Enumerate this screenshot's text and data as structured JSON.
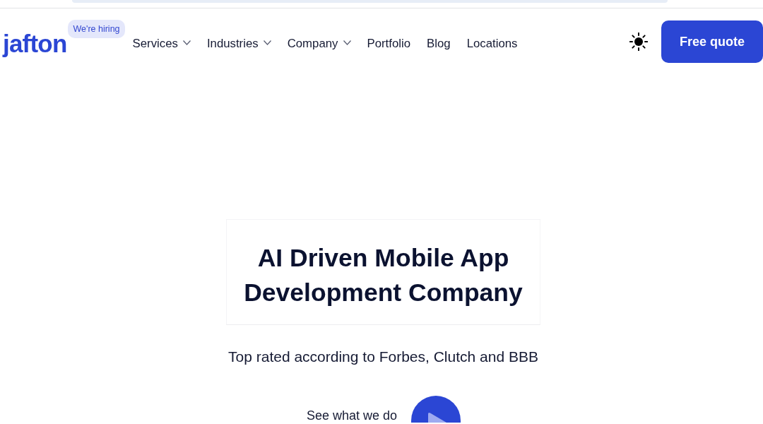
{
  "header": {
    "logo": "jafton",
    "hiring_badge": "We're hiring",
    "nav": [
      {
        "label": "Services",
        "dropdown": true
      },
      {
        "label": "Industries",
        "dropdown": true
      },
      {
        "label": "Company",
        "dropdown": true
      },
      {
        "label": "Portfolio",
        "dropdown": false
      },
      {
        "label": "Blog",
        "dropdown": false
      },
      {
        "label": "Locations",
        "dropdown": false
      }
    ],
    "cta": "Free quote"
  },
  "hero": {
    "title": "AI Driven Mobile App Development Company",
    "subtitle": "Top rated according to Forbes, Clutch and BBB",
    "video_link": "See what we do"
  }
}
